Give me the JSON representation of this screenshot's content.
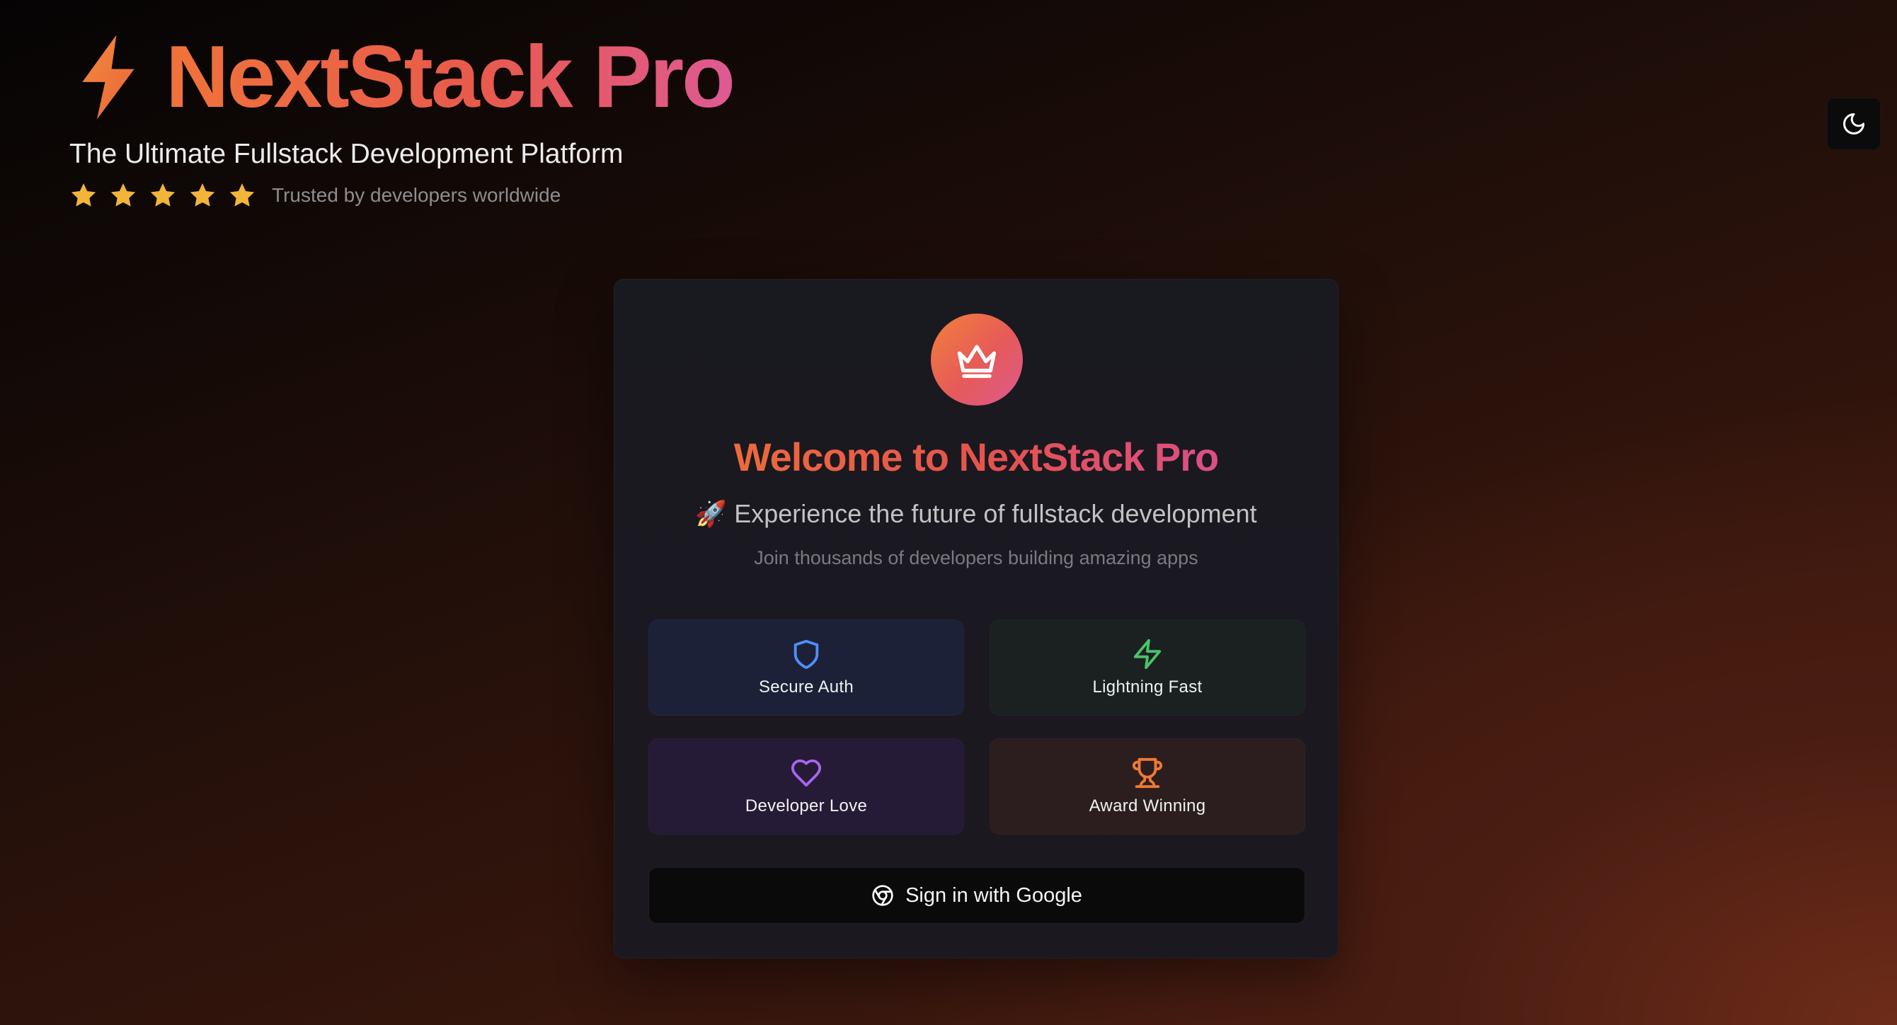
{
  "header": {
    "logo_icon": "lightning-bolt-icon",
    "title": "NextStack Pro",
    "tagline": "The Ultimate Fullstack Development Platform",
    "rating": {
      "stars": 5,
      "max": 5,
      "text": "Trusted by developers worldwide"
    }
  },
  "theme_toggle": {
    "icon": "moon-icon"
  },
  "card": {
    "badge_icon": "crown-icon",
    "title": "Welcome to NextStack Pro",
    "subtitle": "🚀 Experience the future of fullstack development",
    "note": "Join thousands of developers building amazing apps",
    "features": [
      {
        "label": "Secure Auth",
        "icon": "shield-icon",
        "color": "#4f8ff7"
      },
      {
        "label": "Lightning Fast",
        "icon": "zap-icon",
        "color": "#4cc26a"
      },
      {
        "label": "Developer Love",
        "icon": "heart-icon",
        "color": "#a865f0"
      },
      {
        "label": "Award Winning",
        "icon": "trophy-icon",
        "color": "#f07a34"
      }
    ],
    "signin": {
      "label": "Sign in with Google",
      "icon": "chrome-icon"
    }
  },
  "colors": {
    "accent_orange": "#f0733a",
    "accent_pink": "#de5a93",
    "star": "#f2b53a"
  }
}
